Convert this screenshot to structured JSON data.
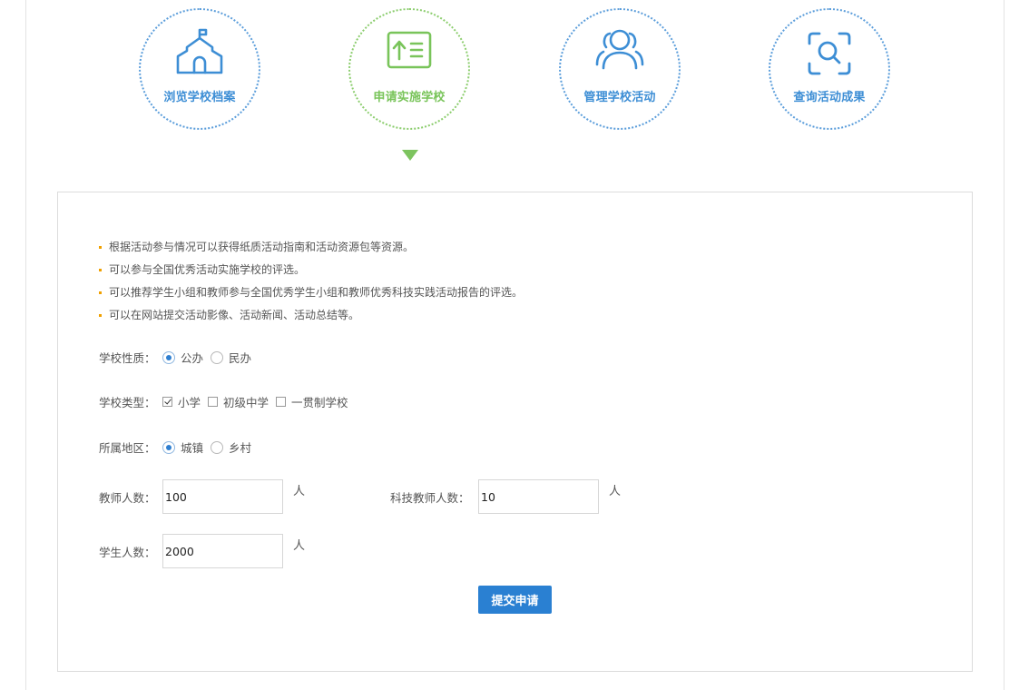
{
  "steps": [
    {
      "label": "浏览学校档案",
      "icon": "school-building-icon",
      "active": false
    },
    {
      "label": "申请实施学校",
      "icon": "upload-list-icon",
      "active": true
    },
    {
      "label": "管理学校活动",
      "icon": "users-group-icon",
      "active": false
    },
    {
      "label": "查询活动成果",
      "icon": "search-scan-icon",
      "active": false
    }
  ],
  "colors": {
    "accent_blue": "#3d8ed5",
    "accent_green": "#79c45a",
    "bullet": "#f0a000",
    "button": "#2a80d2"
  },
  "benefits": [
    "根据活动参与情况可以获得纸质活动指南和活动资源包等资源。",
    "可以参与全国优秀活动实施学校的评选。",
    "可以推荐学生小组和教师参与全国优秀学生小组和教师优秀科技实践活动报告的评选。",
    "可以在网站提交活动影像、活动新闻、活动总结等。"
  ],
  "form": {
    "school_nature": {
      "label": "学校性质：",
      "options": [
        {
          "label": "公办",
          "checked": true
        },
        {
          "label": "民办",
          "checked": false
        }
      ]
    },
    "school_type": {
      "label": "学校类型：",
      "options": [
        {
          "label": "小学",
          "checked": true
        },
        {
          "label": "初级中学",
          "checked": false
        },
        {
          "label": "一贯制学校",
          "checked": false
        }
      ]
    },
    "region": {
      "label": "所属地区：",
      "options": [
        {
          "label": "城镇",
          "checked": true
        },
        {
          "label": "乡村",
          "checked": false
        }
      ]
    },
    "teacher_count": {
      "label": "教师人数：",
      "value": "100",
      "unit": "人"
    },
    "sci_teacher_count": {
      "label": "科技教师人数：",
      "value": "10",
      "unit": "人"
    },
    "student_count": {
      "label": "学生人数：",
      "value": "2000",
      "unit": "人"
    },
    "submit_label": "提交申请"
  }
}
